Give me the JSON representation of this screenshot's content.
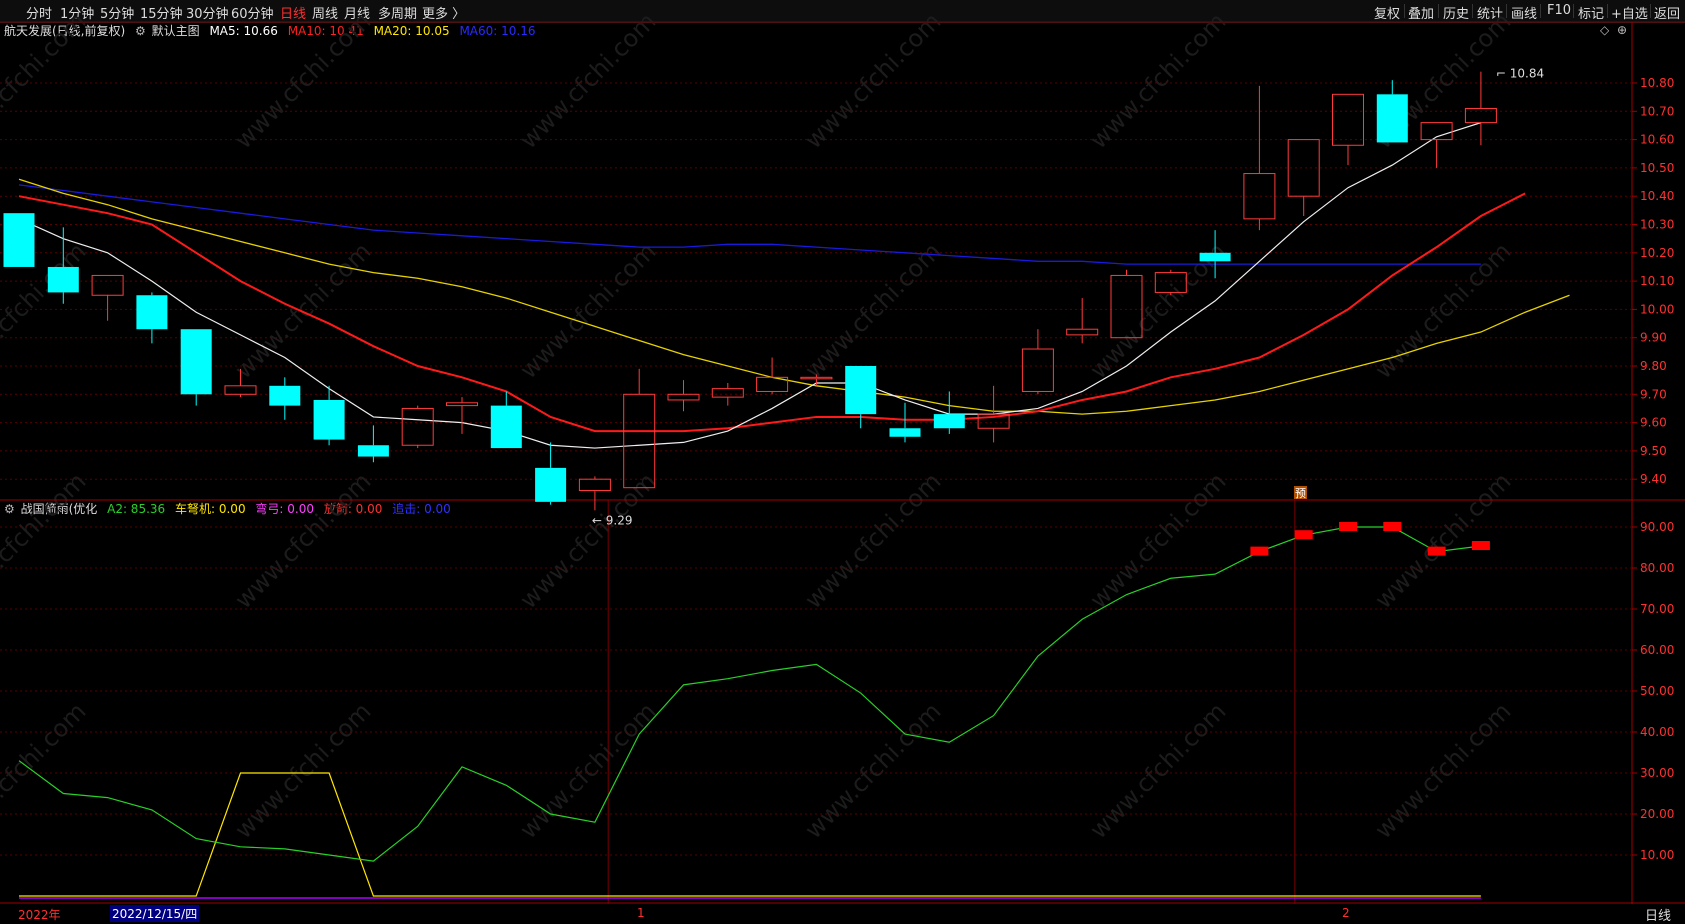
{
  "toolbar": {
    "periods": [
      "分时",
      "1分钟",
      "5分钟",
      "15分钟",
      "30分钟",
      "60分钟",
      "日线",
      "周线",
      "月线",
      "多周期",
      "更多 〉"
    ],
    "active_period": "日线",
    "right_buttons": [
      "复权",
      "叠加",
      "历史",
      "统计",
      "画线",
      "F10",
      "标记",
      "+自选",
      "返回"
    ]
  },
  "main_panel": {
    "stock_title": "航天发展(日线,前复权)",
    "template_label": "默认主图",
    "ma_labels": [
      {
        "text": "MA5: 10.66",
        "color": "#ffffff"
      },
      {
        "text": "MA10: 10.41",
        "color": "#ff2020"
      },
      {
        "text": "MA20: 10.05",
        "color": "#ffe600"
      },
      {
        "text": "MA60: 10.16",
        "color": "#2a2aff"
      }
    ],
    "price_axis": [
      "10.80",
      "10.70",
      "10.60",
      "10.50",
      "10.40",
      "10.30",
      "10.20",
      "10.10",
      "10.00",
      "9.90",
      "9.80",
      "9.70",
      "9.60",
      "9.50",
      "9.40"
    ],
    "high_annotation": "10.84",
    "low_annotation": "9.29",
    "forecast_label": "预",
    "top_icons": [
      "◇",
      "⊕"
    ]
  },
  "sub_panel": {
    "indicator_name": "战国箭雨(优化",
    "labels": [
      {
        "text": "A2: 85.36",
        "color": "#28d028"
      },
      {
        "text": "车弩机: 0.00",
        "color": "#ffe600"
      },
      {
        "text": "弯弓: 0.00",
        "color": "#ff40ff"
      },
      {
        "text": "放箭: 0.00",
        "color": "#ff3030"
      },
      {
        "text": "追击: 0.00",
        "color": "#3030ff"
      }
    ],
    "axis": [
      "90.00",
      "80.00",
      "70.00",
      "60.00",
      "50.00",
      "40.00",
      "30.00",
      "20.00",
      "10.00"
    ]
  },
  "bottom_bar": {
    "date_labels": [
      "2022年",
      "1",
      "2"
    ],
    "cursor_date": "2022/12/15/四",
    "period_label": "日线"
  },
  "watermark": "www.cfchi.com",
  "colors": {
    "up": "#ff3b3b",
    "down": "#00ffff",
    "ma5": "#eeeeee",
    "ma10": "#ff1a1a",
    "ma20": "#e6d200",
    "ma60": "#1a1adc",
    "grid": "#5a0000"
  },
  "chart_data": {
    "type": "candlestick",
    "candles": [
      {
        "o": 10.34,
        "c": 10.15,
        "h": 10.34,
        "l": 10.15
      },
      {
        "o": 10.15,
        "c": 10.06,
        "h": 10.29,
        "l": 10.02
      },
      {
        "o": 10.05,
        "c": 10.12,
        "h": 10.12,
        "l": 9.96
      },
      {
        "o": 10.05,
        "c": 9.93,
        "h": 10.06,
        "l": 9.88
      },
      {
        "o": 9.93,
        "c": 9.7,
        "h": 9.93,
        "l": 9.66
      },
      {
        "o": 9.7,
        "c": 9.73,
        "h": 9.79,
        "l": 9.69
      },
      {
        "o": 9.73,
        "c": 9.66,
        "h": 9.76,
        "l": 9.61
      },
      {
        "o": 9.68,
        "c": 9.54,
        "h": 9.73,
        "l": 9.52
      },
      {
        "o": 9.52,
        "c": 9.48,
        "h": 9.59,
        "l": 9.46
      },
      {
        "o": 9.52,
        "c": 9.65,
        "h": 9.66,
        "l": 9.51
      },
      {
        "o": 9.66,
        "c": 9.67,
        "h": 9.69,
        "l": 9.56
      },
      {
        "o": 9.66,
        "c": 9.51,
        "h": 9.71,
        "l": 9.51
      },
      {
        "o": 9.44,
        "c": 9.32,
        "h": 9.53,
        "l": 9.31
      },
      {
        "o": 9.36,
        "c": 9.4,
        "h": 9.41,
        "l": 9.29
      },
      {
        "o": 9.37,
        "c": 9.7,
        "h": 9.79,
        "l": 9.37
      },
      {
        "o": 9.68,
        "c": 9.7,
        "h": 9.75,
        "l": 9.64
      },
      {
        "o": 9.69,
        "c": 9.72,
        "h": 9.74,
        "l": 9.66
      },
      {
        "o": 9.71,
        "c": 9.76,
        "h": 9.83,
        "l": 9.7
      },
      {
        "o": 9.76,
        "c": 9.76,
        "h": 9.77,
        "l": 9.73
      },
      {
        "o": 9.8,
        "c": 9.63,
        "h": 9.8,
        "l": 9.58
      },
      {
        "o": 9.58,
        "c": 9.55,
        "h": 9.67,
        "l": 9.53
      },
      {
        "o": 9.63,
        "c": 9.58,
        "h": 9.71,
        "l": 9.56
      },
      {
        "o": 9.58,
        "c": 9.63,
        "h": 9.73,
        "l": 9.53
      },
      {
        "o": 9.71,
        "c": 9.86,
        "h": 9.93,
        "l": 9.7
      },
      {
        "o": 9.91,
        "c": 9.93,
        "h": 10.04,
        "l": 9.88
      },
      {
        "o": 9.9,
        "c": 10.12,
        "h": 10.14,
        "l": 9.9
      },
      {
        "o": 10.06,
        "c": 10.13,
        "h": 10.14,
        "l": 10.05
      },
      {
        "o": 10.2,
        "c": 10.17,
        "h": 10.28,
        "l": 10.11
      },
      {
        "o": 10.32,
        "c": 10.48,
        "h": 10.79,
        "l": 10.28
      },
      {
        "o": 10.4,
        "c": 10.6,
        "h": 10.6,
        "l": 10.33
      },
      {
        "o": 10.58,
        "c": 10.76,
        "h": 10.76,
        "l": 10.51
      },
      {
        "o": 10.76,
        "c": 10.59,
        "h": 10.81,
        "l": 10.59
      },
      {
        "o": 10.6,
        "c": 10.66,
        "h": 10.66,
        "l": 10.5
      },
      {
        "o": 10.66,
        "c": 10.71,
        "h": 10.84,
        "l": 10.58
      }
    ],
    "ma5": [
      10.32,
      10.25,
      10.2,
      10.1,
      9.99,
      9.91,
      9.83,
      9.72,
      9.62,
      9.61,
      9.6,
      9.57,
      9.52,
      9.51,
      9.52,
      9.53,
      9.57,
      9.65,
      9.74,
      9.74,
      9.68,
      9.63,
      9.63,
      9.65,
      9.71,
      9.8,
      9.92,
      10.03,
      10.17,
      10.31,
      10.43,
      10.51,
      10.61,
      10.66
    ],
    "ma10": [
      10.4,
      10.37,
      10.34,
      10.3,
      10.2,
      10.1,
      10.02,
      9.95,
      9.87,
      9.8,
      9.76,
      9.71,
      9.62,
      9.57,
      9.57,
      9.57,
      9.58,
      9.6,
      9.62,
      9.62,
      9.61,
      9.61,
      9.62,
      9.64,
      9.68,
      9.71,
      9.76,
      9.79,
      9.83,
      9.91,
      10.0,
      10.12,
      10.22,
      10.33,
      10.41
    ],
    "ma20": [
      10.46,
      10.41,
      10.37,
      10.32,
      10.28,
      10.24,
      10.2,
      10.16,
      10.13,
      10.11,
      10.08,
      10.04,
      9.99,
      9.94,
      9.89,
      9.84,
      9.8,
      9.76,
      9.73,
      9.71,
      9.69,
      9.66,
      9.64,
      9.64,
      9.63,
      9.64,
      9.66,
      9.68,
      9.71,
      9.75,
      9.79,
      9.83,
      9.88,
      9.92,
      9.99,
      10.05
    ],
    "ma60": [
      10.44,
      10.42,
      10.4,
      10.38,
      10.36,
      10.34,
      10.32,
      10.3,
      10.28,
      10.27,
      10.26,
      10.25,
      10.24,
      10.23,
      10.22,
      10.22,
      10.23,
      10.23,
      10.22,
      10.21,
      10.2,
      10.19,
      10.18,
      10.17,
      10.17,
      10.16,
      10.16,
      10.16,
      10.16,
      10.16,
      10.16,
      10.16,
      10.16,
      10.16
    ],
    "a2": [
      33,
      25,
      24,
      21,
      14,
      12,
      11.5,
      10,
      8.5,
      17,
      31.5,
      27,
      20,
      18,
      39.5,
      51.5,
      53,
      55,
      56.5,
      49.5,
      39.5,
      37.5,
      44,
      58.5,
      67.5,
      73.5,
      77.5,
      78.5,
      84,
      88,
      90,
      90,
      84,
      85.36
    ],
    "chenuji": [
      0,
      0,
      0,
      0,
      0,
      30,
      30,
      30,
      0,
      0,
      0,
      0,
      0,
      0,
      0,
      0,
      0,
      0,
      0,
      0,
      0,
      0,
      0,
      0,
      0,
      0,
      0,
      0,
      0,
      0,
      0,
      0,
      0,
      0
    ],
    "fangjian_bars": [
      28,
      29,
      30,
      31,
      32,
      33
    ]
  }
}
